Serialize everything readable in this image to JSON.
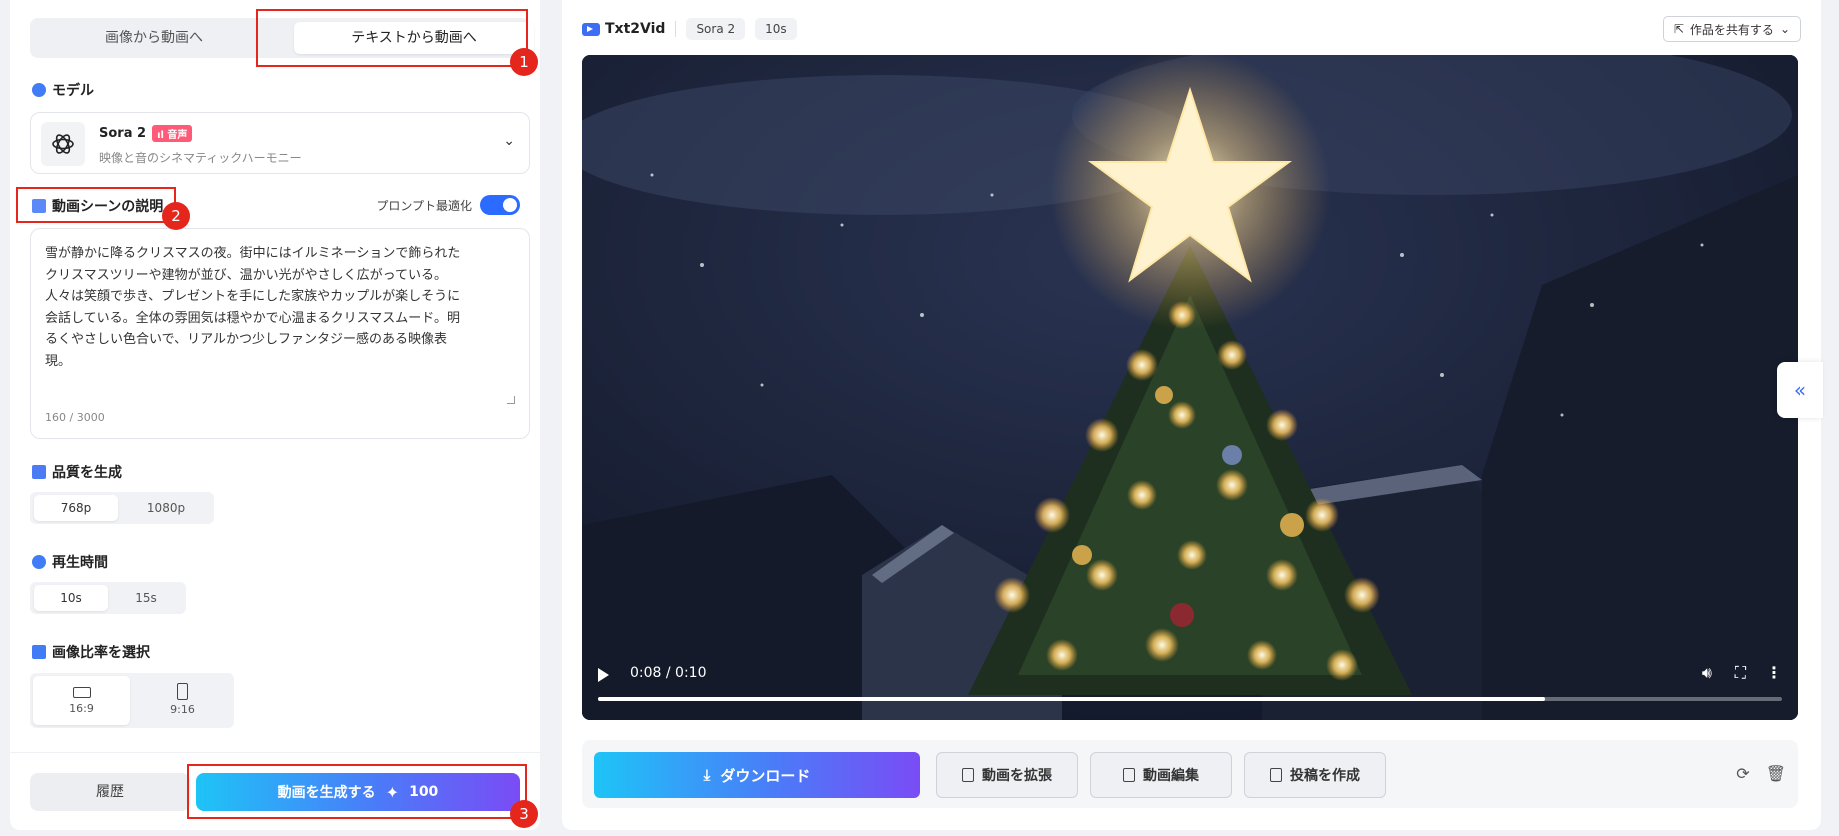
{
  "mode_tabs": {
    "image_to_video": "画像から動画へ",
    "text_to_video": "テキストから動画へ"
  },
  "model": {
    "section_title": "モデル",
    "name": "Sora 2",
    "badge": "音声",
    "description": "映像と音のシネマティックハーモニー"
  },
  "scene": {
    "section_title": "動画シーンの説明",
    "prompt_optimize_label": "プロンプト最適化",
    "prompt_optimize_on": true,
    "text": "雪が静かに降るクリスマスの夜。街中にはイルミネーションで飾られた\nクリスマスツリーや建物が並び、温かい光がやさしく広がっている。\n人々は笑顔で歩き、プレゼントを手にした家族やカップルが楽しそうに\n会話している。全体の雰囲気は穏やかで心温まるクリスマスムード。明\nるくやさしい色合いで、リアルかつ少しファンタジー感のある映像表\n現。",
    "char_count": "160 / 3000"
  },
  "quality": {
    "section_title": "品質を生成",
    "options": [
      "768p",
      "1080p"
    ],
    "selected": "768p"
  },
  "duration": {
    "section_title": "再生時間",
    "options": [
      "10s",
      "15s"
    ],
    "selected": "10s"
  },
  "ratio": {
    "section_title": "画像比率を選択",
    "options": [
      "16:9",
      "9:16"
    ],
    "selected": "16:9"
  },
  "bottom": {
    "history": "履歴",
    "generate": "動画を生成する",
    "cost": "100"
  },
  "annotations": [
    "1",
    "2",
    "3"
  ],
  "header": {
    "brand": "Txt2Vid",
    "model_pill": "Sora 2",
    "duration_pill": "10s",
    "share": "作品を共有する"
  },
  "player": {
    "time": "0:08 / 0:10",
    "progress": 0.8
  },
  "actions": {
    "download": "ダウンロード",
    "extend": "動画を拡張",
    "edit": "動画編集",
    "post": "投稿を作成"
  },
  "colors": {
    "accent": "#2b6bff",
    "annotation_red": "#e5261c",
    "gradient_start": "#1ec4f7",
    "gradient_end": "#7a4cf5"
  }
}
